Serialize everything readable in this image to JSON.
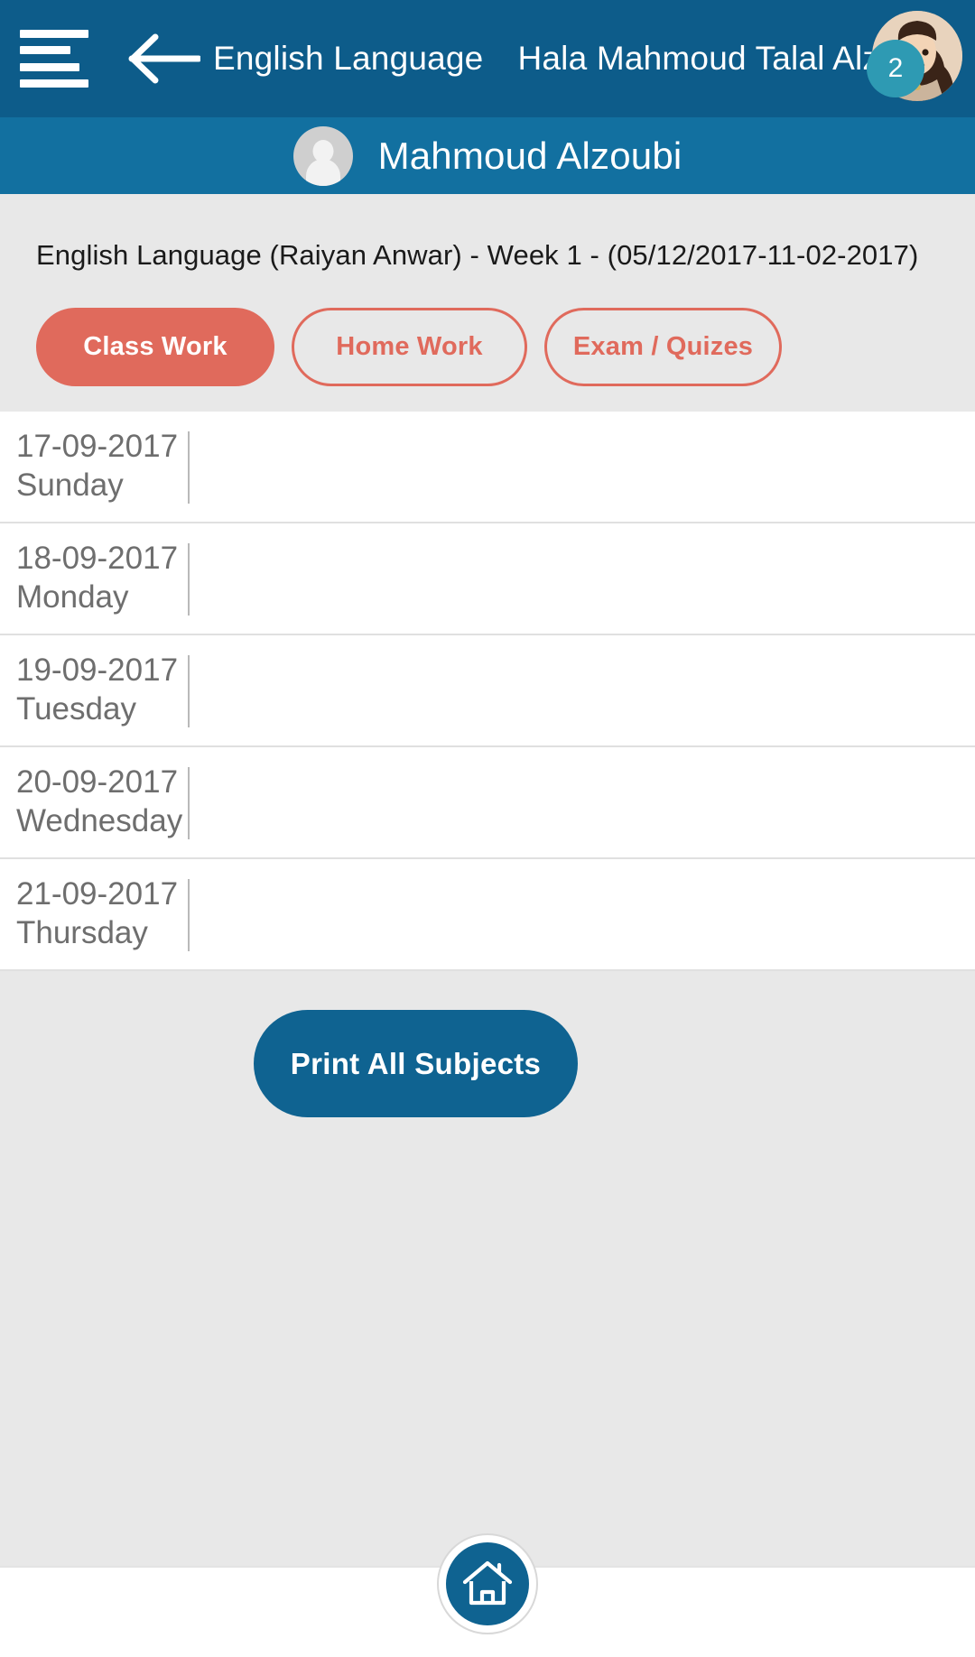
{
  "appbar": {
    "menu_icon": "hamburger-menu-icon",
    "back_icon": "back-arrow-icon",
    "title": "English Language",
    "user_name": "Hala Mahmoud Talal Alzou'bi",
    "avatar_icon": "user-photo-avatar",
    "badge_count": "2",
    "background_color": "#0d5c8a",
    "badge_color": "#2e9ab3"
  },
  "subbar": {
    "avatar_icon": "student-placeholder-avatar",
    "student_name": "Mahmoud Alzoubi",
    "background_color": "#1270a0"
  },
  "filter": {
    "week_line": "English Language (Raiyan Anwar) - Week 1 - (05/12/2017-11-02-2017)",
    "background_color": "#e8e8e8",
    "accent_color": "#e06a5c",
    "tabs": [
      {
        "label": "Class Work",
        "active": true
      },
      {
        "label": "Home Work",
        "active": false
      },
      {
        "label": "Exam / Quizes",
        "active": false
      }
    ]
  },
  "day_list": [
    {
      "date": "17-09-2017",
      "day": "Sunday",
      "content": ""
    },
    {
      "date": "18-09-2017",
      "day": "Monday",
      "content": ""
    },
    {
      "date": "19-09-2017",
      "day": "Tuesday",
      "content": ""
    },
    {
      "date": "20-09-2017",
      "day": "Wednesday",
      "content": ""
    },
    {
      "date": "21-09-2017",
      "day": "Thursday",
      "content": ""
    }
  ],
  "print": {
    "label": "Print All Subjects",
    "color": "#0f6391"
  },
  "bottom_nav": {
    "home_icon": "home-icon",
    "home_color": "#0f6391"
  }
}
